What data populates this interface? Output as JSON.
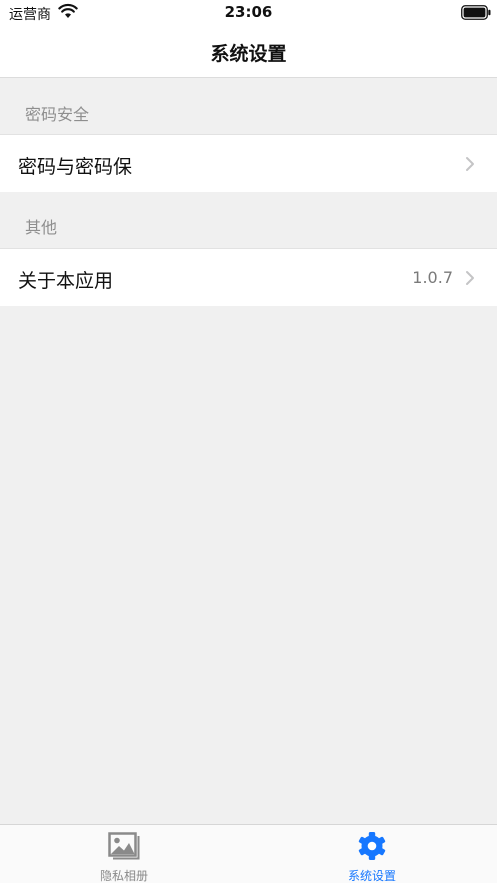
{
  "status_bar": {
    "carrier": "运营商",
    "time": "23:06",
    "wifi_icon": "wifi-icon",
    "battery_icon": "battery-full-icon"
  },
  "nav": {
    "title": "系统设置"
  },
  "sections": [
    {
      "header": "密码安全",
      "rows": [
        {
          "label": "密码与密码保",
          "detail": ""
        }
      ]
    },
    {
      "header": "其他",
      "rows": [
        {
          "label": "关于本应用",
          "detail": "1.0.7"
        }
      ]
    }
  ],
  "tab_bar": {
    "tabs": [
      {
        "label": "隐私相册",
        "icon": "photo-album-icon",
        "selected": false
      },
      {
        "label": "系统设置",
        "icon": "gear-icon",
        "selected": true
      }
    ]
  },
  "colors": {
    "accent": "#1677ff",
    "inactive": "#8a8a8a",
    "background": "#f0f0f0"
  }
}
